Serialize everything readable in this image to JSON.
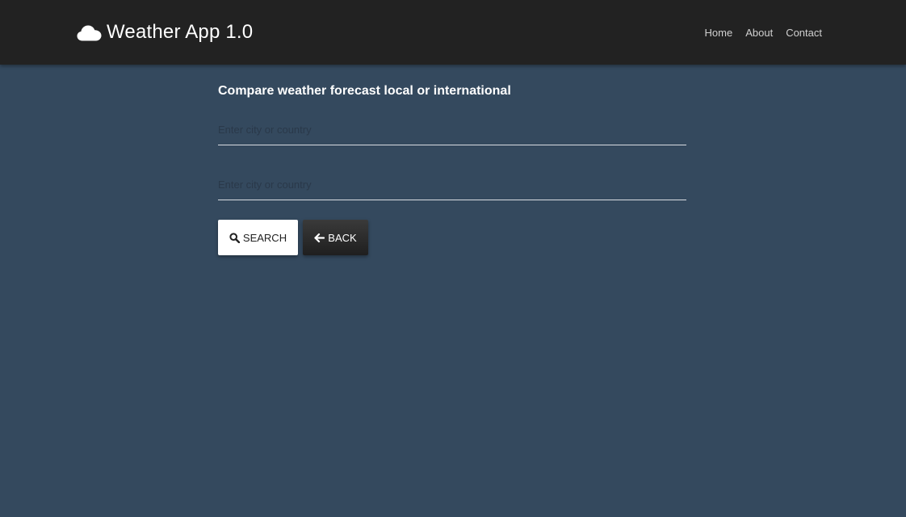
{
  "app": {
    "title": "Weather App 1.0",
    "brand_icon": "cloud-icon"
  },
  "nav": {
    "items": [
      {
        "label": "Home"
      },
      {
        "label": "About"
      },
      {
        "label": "Contact"
      }
    ]
  },
  "main": {
    "heading": "Compare weather forecast local or international",
    "inputs": [
      {
        "value": "",
        "placeholder": "Enter city or country"
      },
      {
        "value": "",
        "placeholder": "Enter city or country"
      }
    ],
    "search_button": {
      "label": "SEARCH",
      "icon": "search-icon"
    },
    "back_button": {
      "label": "BACK",
      "icon": "arrow-left-icon"
    }
  },
  "colors": {
    "navbar": "#222222",
    "background": "#34495e",
    "search_button": "#ffffff",
    "back_button": "#2b2b2b"
  }
}
